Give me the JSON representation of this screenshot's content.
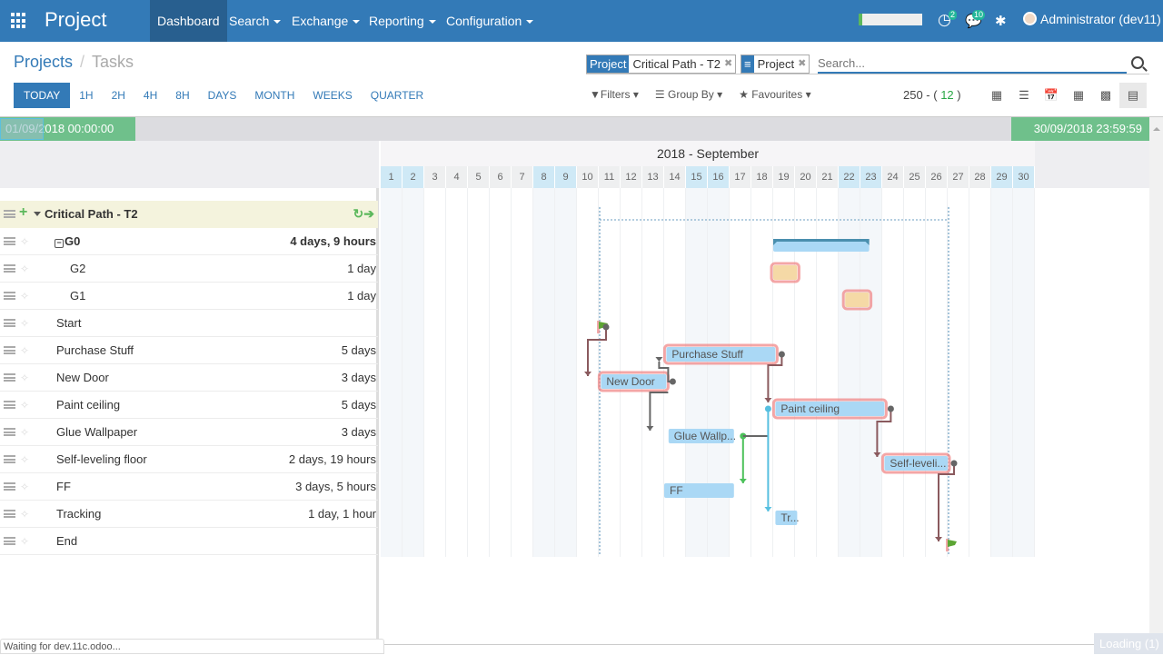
{
  "navbar": {
    "app_title": "Project",
    "menus": [
      {
        "label": "Dashboard",
        "active": true,
        "dropdown": false
      },
      {
        "label": "Search",
        "dropdown": true
      },
      {
        "label": "Exchange",
        "dropdown": true
      },
      {
        "label": "Reporting",
        "dropdown": true
      },
      {
        "label": "Configuration",
        "dropdown": true
      }
    ],
    "activity_count": "2",
    "message_count": "10",
    "user": "Administrator (dev11)"
  },
  "breadcrumb": {
    "parent": "Projects",
    "separator": "/",
    "current": "Tasks"
  },
  "scales": [
    "TODAY",
    "1H",
    "2H",
    "4H",
    "8H",
    "DAYS",
    "MONTH",
    "WEEKS",
    "QUARTER"
  ],
  "search": {
    "facets": [
      {
        "label": "Project",
        "value": "Critical Path - T2"
      },
      {
        "label": "≡",
        "value": "Project"
      }
    ],
    "placeholder": "Search..."
  },
  "filters": {
    "filters_label": "Filters",
    "groupby_label": "Group By",
    "favourites_label": "Favourites"
  },
  "pager": {
    "total": "250 - (",
    "count": "12",
    "close": ")"
  },
  "views": [
    "kanban",
    "list",
    "calendar",
    "pivot",
    "graph",
    "gantt"
  ],
  "range": {
    "start": "01/09/2018 00:00:00",
    "end": "30/09/2018 23:59:59"
  },
  "gantt": {
    "month_label": "2018 - September",
    "days": [
      1,
      2,
      3,
      4,
      5,
      6,
      7,
      8,
      9,
      10,
      11,
      12,
      13,
      14,
      15,
      16,
      17,
      18,
      19,
      20,
      21,
      22,
      23,
      24,
      25,
      26,
      27,
      28,
      29,
      30
    ],
    "weekend_days": [
      1,
      2,
      8,
      9,
      15,
      16,
      22,
      23,
      29,
      30
    ],
    "group": {
      "name": "Critical Path - T2"
    },
    "rows": [
      {
        "name": "G0",
        "duration": "4 days, 9 hours",
        "level": 0,
        "bold": true,
        "collapsible": true
      },
      {
        "name": "G2",
        "duration": "1 day",
        "level": 1
      },
      {
        "name": "G1",
        "duration": "1 day",
        "level": 1
      },
      {
        "name": "Start",
        "duration": "",
        "level": 0
      },
      {
        "name": "Purchase Stuff",
        "duration": "5 days",
        "level": 0
      },
      {
        "name": "New Door",
        "duration": "3 days",
        "level": 0
      },
      {
        "name": "Paint ceiling",
        "duration": "5 days",
        "level": 0
      },
      {
        "name": "Glue Wallpaper",
        "duration": "3 days",
        "level": 0
      },
      {
        "name": "Self-leveling floor",
        "duration": "2 days, 19 hours",
        "level": 0
      },
      {
        "name": "FF",
        "duration": "3 days, 5 hours",
        "level": 0
      },
      {
        "name": "Tracking",
        "duration": "1 day, 1 hour",
        "level": 0
      },
      {
        "name": "End",
        "duration": "",
        "level": 0
      }
    ],
    "bars": [
      {
        "row": 0,
        "start": 19.0,
        "end": 23.4,
        "label": "",
        "type": "summary"
      },
      {
        "row": 1,
        "start": 19.0,
        "end": 20.1,
        "label": "",
        "type": "critical-orange"
      },
      {
        "row": 2,
        "start": 22.3,
        "end": 23.4,
        "label": "",
        "type": "critical-orange"
      },
      {
        "row": 3,
        "start": 11.0,
        "end": 11.3,
        "label": "",
        "type": "milestone"
      },
      {
        "row": 4,
        "start": 14.1,
        "end": 19.1,
        "label": "Purchase Stuff",
        "type": "critical"
      },
      {
        "row": 5,
        "start": 11.1,
        "end": 14.1,
        "label": "New Door",
        "type": "critical"
      },
      {
        "row": 6,
        "start": 19.1,
        "end": 24.1,
        "label": "Paint ceiling",
        "type": "critical"
      },
      {
        "row": 7,
        "start": 14.2,
        "end": 17.2,
        "label": "Glue Wallp...",
        "type": "normal"
      },
      {
        "row": 8,
        "start": 24.1,
        "end": 27.0,
        "label": "Self-leveli...",
        "type": "critical"
      },
      {
        "row": 9,
        "start": 14.0,
        "end": 17.2,
        "label": "FF",
        "type": "normal"
      },
      {
        "row": 10,
        "start": 19.1,
        "end": 20.1,
        "label": "Tr...",
        "type": "normal"
      },
      {
        "row": 11,
        "start": 27.0,
        "end": 27.3,
        "label": "",
        "type": "milestone"
      }
    ],
    "colors": {
      "bar": "#aad8f5",
      "critical_glow": "#f08080",
      "summary_cap": "#4a8fae",
      "orange": "#f5d9a6",
      "link_critical": "#8a5a5e",
      "link_normal": "#666666",
      "link_ff": "#4cc15a",
      "link_track": "#56bfe0",
      "milestone": "#5ca534"
    }
  },
  "status_bar": "Waiting for dev.11c.odoo...",
  "loading": "Loading (1)"
}
